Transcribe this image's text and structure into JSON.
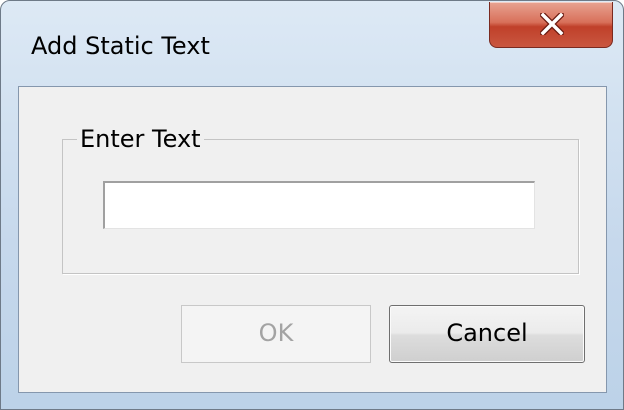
{
  "window": {
    "title": "Add Static Text"
  },
  "title_bar": {
    "close_icon": "close-x-icon",
    "close_color": "#c7452f"
  },
  "group": {
    "label": "Enter Text"
  },
  "text_field": {
    "value": "",
    "placeholder": ""
  },
  "buttons": {
    "ok_label": "OK",
    "cancel_label": "Cancel"
  },
  "colors": {
    "dialog_background": "#f0f0f0",
    "frame_tint": "#c6d8ec",
    "disabled_text": "#a3a3a3"
  }
}
